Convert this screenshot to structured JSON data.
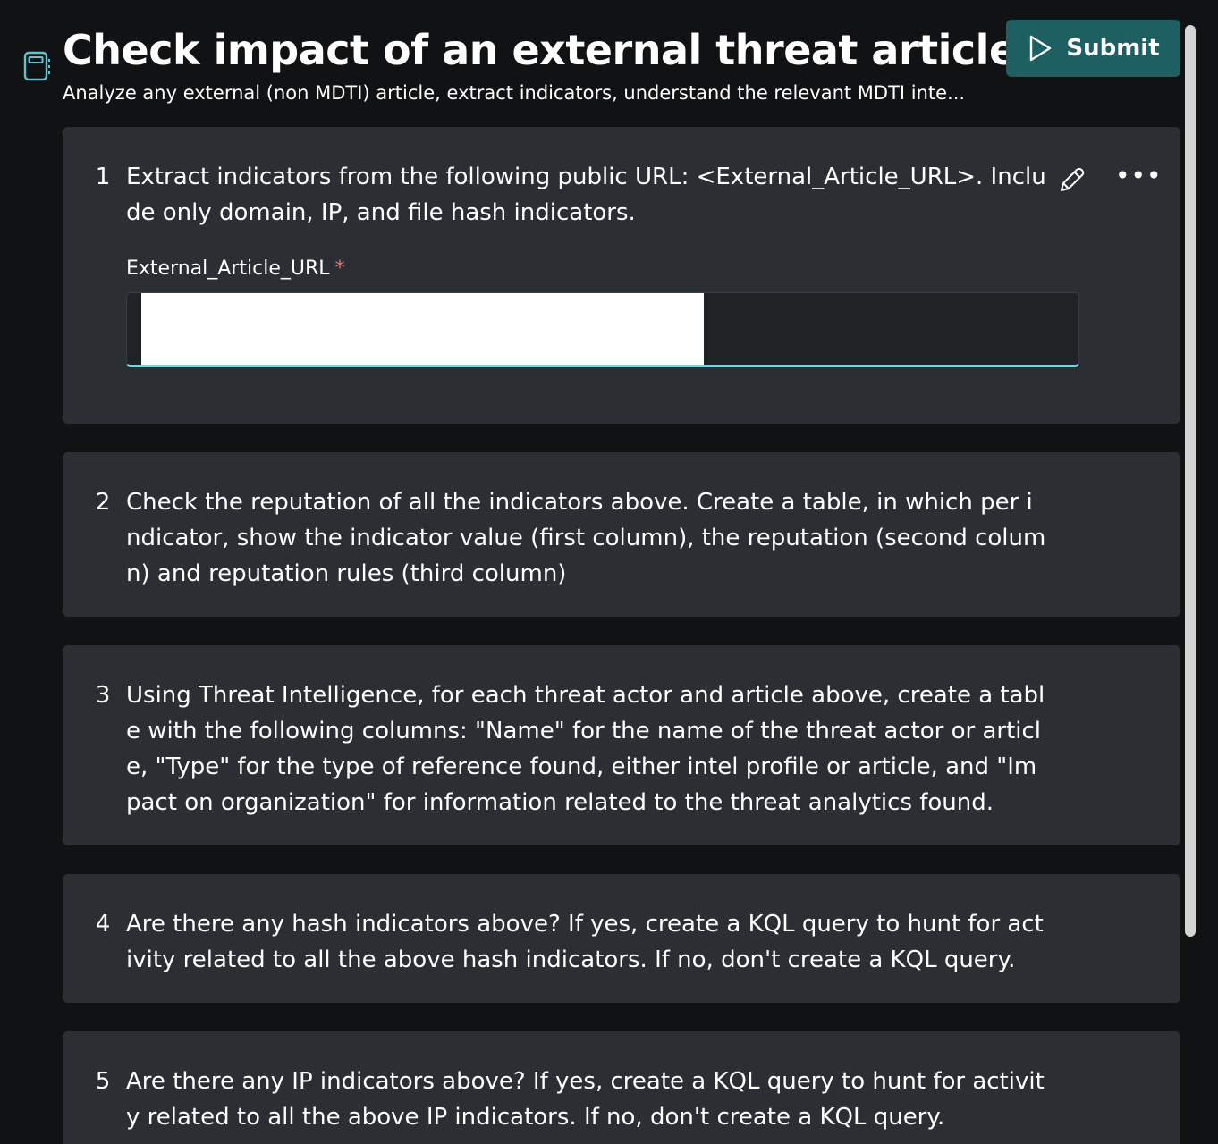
{
  "header": {
    "title": "Check impact of an external threat article",
    "subtitle": "Analyze any external (non MDTI) article, extract indicators, understand the relevant MDTI inte...",
    "submit_label": "Submit"
  },
  "steps": [
    {
      "number": "1",
      "text": "Extract indicators from the following public URL: <External_Article_URL>. Include only domain, IP, and file hash indicators.",
      "field_label": "External_Article_URL",
      "field_required_mark": "*",
      "field_value": ""
    },
    {
      "number": "2",
      "text": "Check the reputation of all the indicators above. Create a table, in which per indicator, show the indicator value (first column), the reputation (second column) and reputation rules (third column)"
    },
    {
      "number": "3",
      "text": "Using Threat Intelligence, for each threat actor and article above, create a table with the following columns: \"Name\" for the name of the threat actor or article, \"Type\" for the type of reference found, either intel profile or article, and \"Impact on organization\" for information related to the threat analytics found."
    },
    {
      "number": "4",
      "text": "Are there any hash indicators above? If yes, create a KQL query to hunt for activity related to all the above hash indicators. If no, don't create a KQL query."
    },
    {
      "number": "5",
      "text": "Are there any IP indicators above? If yes, create a KQL query to hunt for activity related to all the above IP indicators. If no, don't create a KQL query."
    }
  ],
  "icons": {
    "book": "book-icon",
    "submit": "play-icon",
    "edit": "pencil-icon",
    "more": "more-icon"
  },
  "colors": {
    "background": "#111214",
    "card": "#2b2f33",
    "submit_button": "#1e5f61",
    "input_accent": "#7fcfd6",
    "icon_accent": "#5fc4cc",
    "required": "#e07a7a"
  }
}
